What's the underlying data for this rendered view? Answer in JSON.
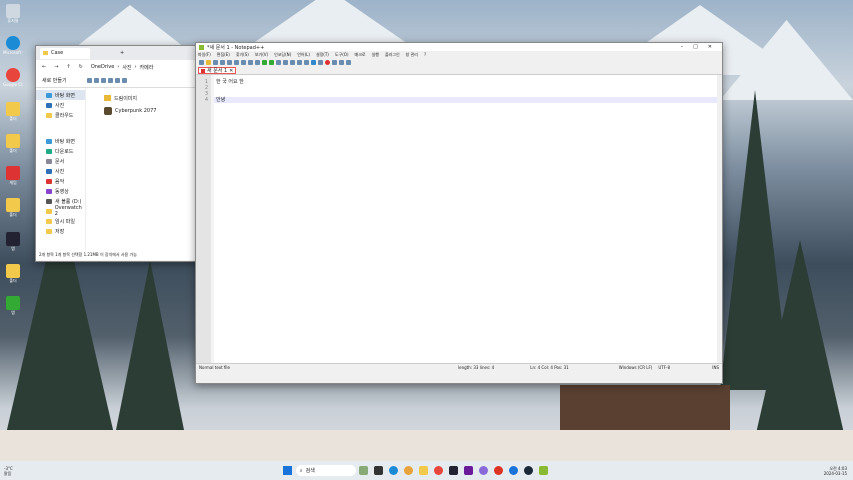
{
  "desktop": {
    "icons": [
      "휴지통",
      "Microsoft Edge",
      "Google Chrome",
      "폴더",
      "폴더",
      "게임",
      "폴더",
      "앱",
      "폴더",
      "앱"
    ]
  },
  "explorer": {
    "tab_title": "Case",
    "new_tab": "+",
    "breadcrumb": [
      "OneDrive",
      "사진",
      "카메라"
    ],
    "new_button": "새로 만들기",
    "nav": [
      "바탕 화면",
      "사진",
      "클라우드",
      "바탕 화면",
      "다운로드",
      "문서",
      "사진",
      "음악",
      "동영상",
      "새 볼륨 (D:)",
      "Overwatch 2",
      "임시 파일",
      "저장"
    ],
    "items": [
      "드림이미지",
      "Cyberpunk 2077"
    ],
    "status": "2개 항목   1개 항목 선택함 1.21MB   이 장치에서 사용 가능"
  },
  "notepad": {
    "title": "*새 문서 1 - Notepad++",
    "menu": [
      "파일(F)",
      "편집(E)",
      "찾기(S)",
      "보기(V)",
      "인코딩(N)",
      "언어(L)",
      "설정(T)",
      "도구(O)",
      "매크로",
      "실행",
      "플러그인",
      "창 관리",
      "?"
    ],
    "tab": "새 문서 1",
    "lines": [
      {
        "n": "1",
        "t": "한  국  어요  한"
      },
      {
        "n": "2",
        "t": ""
      },
      {
        "n": "3",
        "t": ""
      },
      {
        "n": "4",
        "t": "안녕"
      }
    ],
    "status": {
      "type": "Normal text file",
      "length": "length: 33   lines: 4",
      "pos": "Ln: 4   Col: 4   Pos: 31",
      "eol": "Windows (CR LF)",
      "enc": "UTF-8",
      "mode": "INS"
    }
  },
  "taskbar": {
    "weather_temp": "-3°C",
    "weather_text": "맑음",
    "search": "검색",
    "time": "오전 4:03",
    "date": "2024-03-15"
  }
}
